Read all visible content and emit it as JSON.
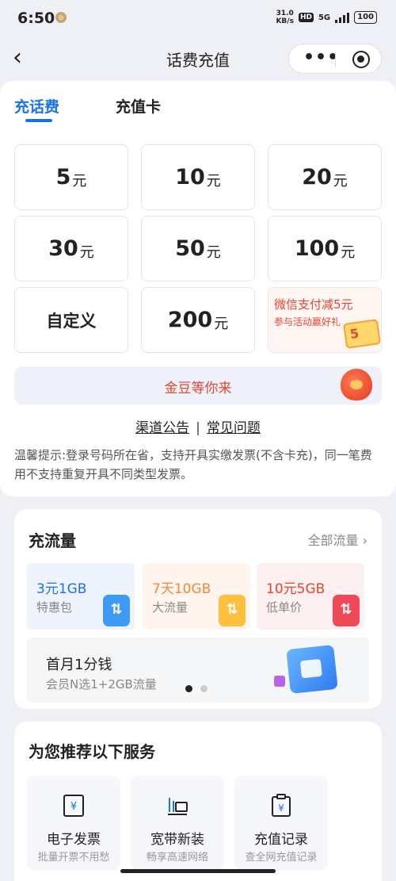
{
  "status": {
    "time": "6:50",
    "net_speed_top": "31.0",
    "net_speed_bottom": "KB/s",
    "hd": "HD",
    "signal": "5G",
    "battery": "100"
  },
  "nav": {
    "title": "话费充值",
    "back_glyph": "‹"
  },
  "tabs": [
    {
      "label": "充话费",
      "active": true
    },
    {
      "label": "充值卡",
      "active": false
    }
  ],
  "amounts": [
    {
      "value": "5",
      "unit": "元"
    },
    {
      "value": "10",
      "unit": "元"
    },
    {
      "value": "20",
      "unit": "元"
    },
    {
      "value": "30",
      "unit": "元"
    },
    {
      "value": "50",
      "unit": "元"
    },
    {
      "value": "100",
      "unit": "元"
    },
    {
      "label": "自定义"
    },
    {
      "value": "200",
      "unit": "元"
    }
  ],
  "promo": {
    "line1": "微信支付减5元",
    "line2": "参与活动赢好礼",
    "voucher_text": "5"
  },
  "gold": {
    "text": "金豆等你来"
  },
  "links": {
    "notice": "渠道公告",
    "sep": "|",
    "faq": "常见问题"
  },
  "tip": "温馨提示:登录号码所在省，支持开具实缴发票(不含卡充)，同一笔费用不支持重复开具不同类型发票。",
  "flow": {
    "title": "充流量",
    "all": "全部流量 ›",
    "packs": [
      {
        "title": "3元1GB",
        "sub": "特惠包"
      },
      {
        "title": "7天10GB",
        "sub": "大流量"
      },
      {
        "title": "10元5GB",
        "sub": "低单价"
      }
    ],
    "banner": {
      "title": "首月1分钱",
      "sub": "会员N选1+2GB流量"
    }
  },
  "services": {
    "title": "为您推荐以下服务",
    "items": [
      {
        "name": "电子发票",
        "desc": "批量开票不用愁",
        "icon": "invoice-icon"
      },
      {
        "name": "宽带新装",
        "desc": "畅享高速网络",
        "icon": "broadband-icon"
      },
      {
        "name": "充值记录",
        "desc": "查全网充值记录",
        "icon": "record-icon"
      }
    ]
  },
  "colors": {
    "accent": "#1a73e8",
    "promo_red": "#e5462e",
    "background": "#eef0f5"
  }
}
